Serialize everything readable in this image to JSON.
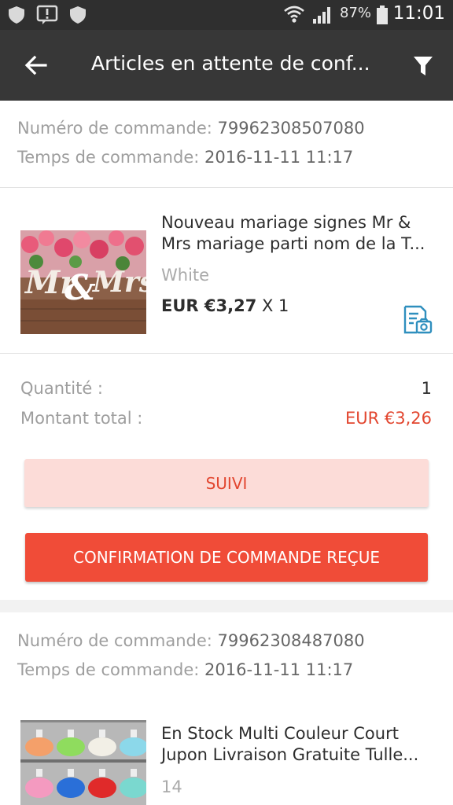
{
  "status_bar": {
    "battery_pct": "87%",
    "time": "11:01"
  },
  "appbar": {
    "title": "Articles en attente de conf..."
  },
  "orders": [
    {
      "number_label": "Numéro de commande:",
      "number_value": "79962308507080",
      "time_label": "Temps de commande:",
      "time_value": "2016-11-11 11:17",
      "product": {
        "title_line1": "Nouveau mariage signes Mr &",
        "title_line2": "Mrs mariage parti nom de la T...",
        "variant": "White",
        "price": "EUR €3,27",
        "qty_suffix": "X 1"
      },
      "quantity_label": "Quantité :",
      "quantity_value": "1",
      "total_label": "Montant total :",
      "total_value": "EUR €3,26",
      "track_button": "SUIVI",
      "confirm_button": "CONFIRMATION DE COMMANDE REÇUE"
    },
    {
      "number_label": "Numéro de commande:",
      "number_value": "79962308487080",
      "time_label": "Temps de commande:",
      "time_value": "2016-11-11 11:17",
      "product": {
        "title_line1": "En Stock Multi Couleur Court",
        "title_line2": "Jupon Livraison Gratuite Tulle...",
        "variant": "14"
      }
    }
  ],
  "colors": {
    "accent": "#f04c38",
    "price_red": "#e2462f",
    "appbar": "#373737"
  }
}
